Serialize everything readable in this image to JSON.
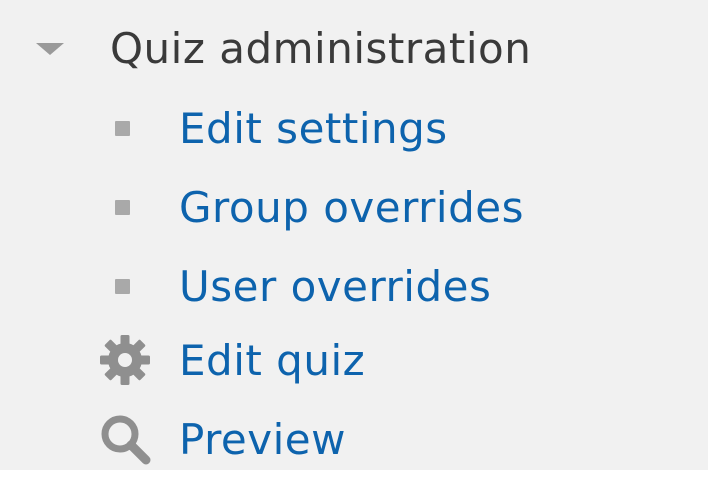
{
  "admin": {
    "heading": "Quiz administration",
    "items": [
      {
        "label": "Edit settings",
        "icon": "bullet"
      },
      {
        "label": "Group overrides",
        "icon": "bullet"
      },
      {
        "label": "User overrides",
        "icon": "bullet"
      },
      {
        "label": "Edit quiz",
        "icon": "gear-icon"
      },
      {
        "label": "Preview",
        "icon": "magnifier-icon"
      }
    ]
  },
  "colors": {
    "panel_bg": "#f1f1f1",
    "link": "#0d63ad",
    "heading_text": "#3a3a3a",
    "icon_gray": "#8f8f8f"
  }
}
